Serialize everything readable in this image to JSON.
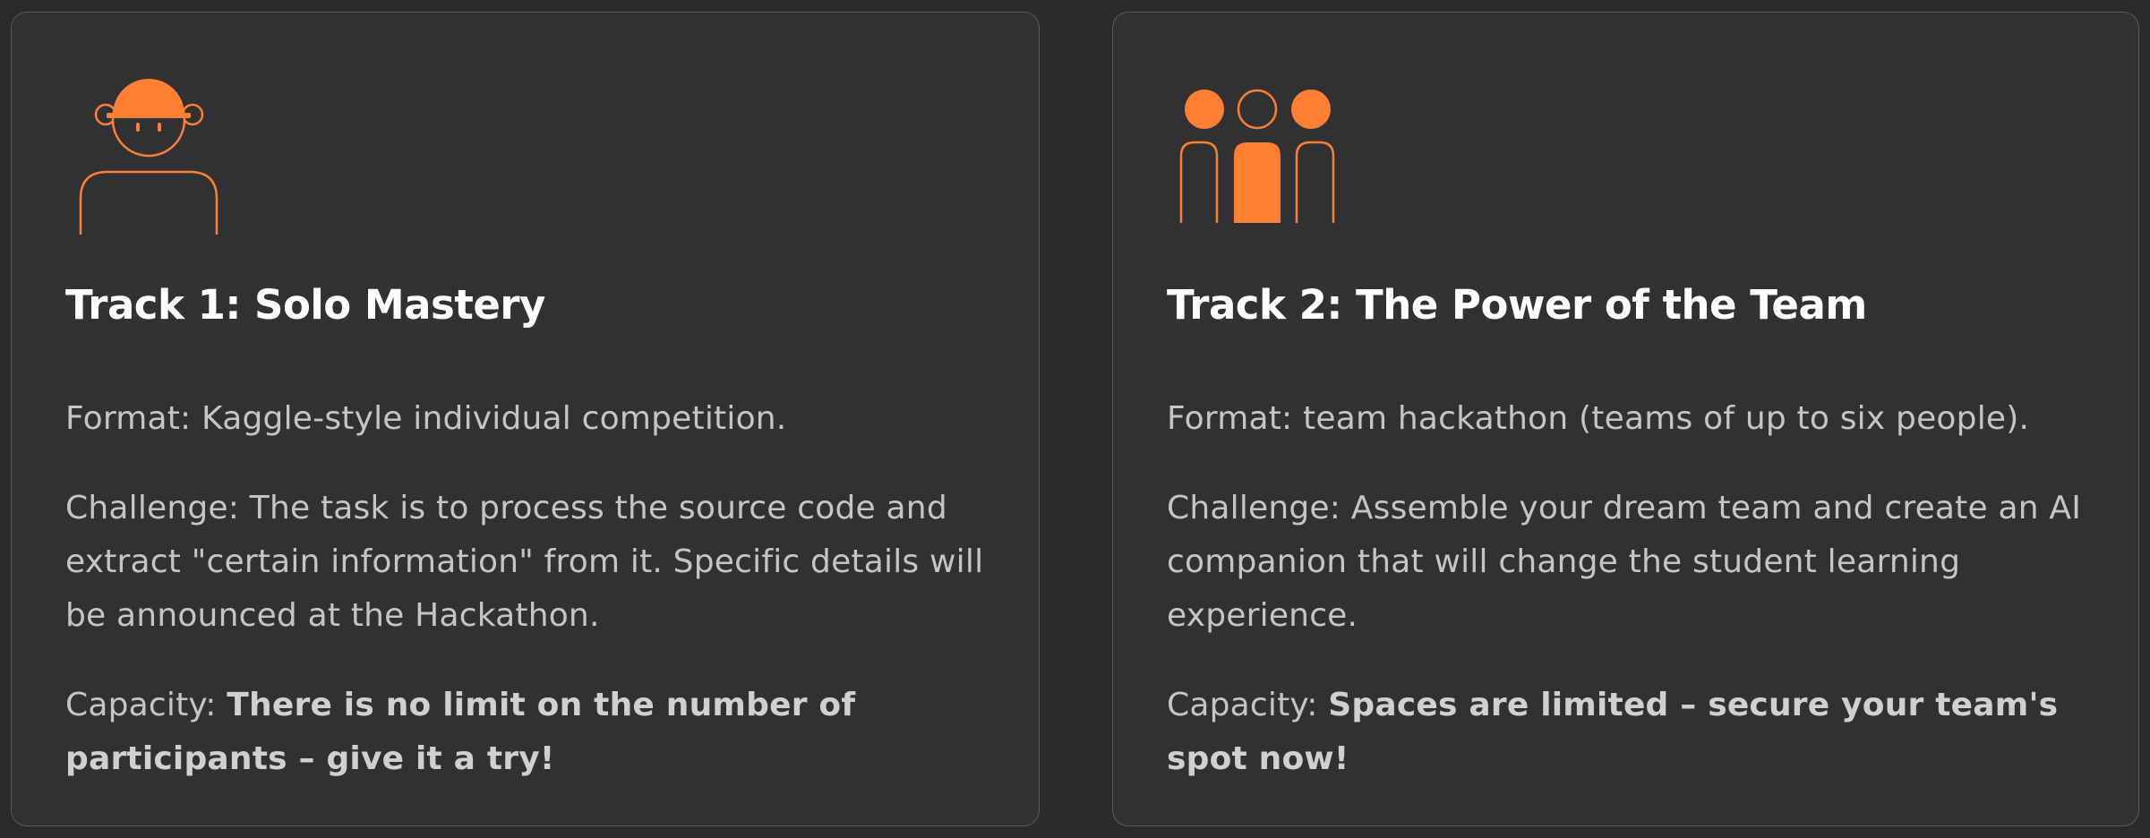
{
  "accent_color": "#ff7f32",
  "tracks": [
    {
      "icon": "solo-person-icon",
      "title": "Track 1: Solo Mastery",
      "format_label": "Format:",
      "format_text": "Kaggle-style individual competition.",
      "challenge_label": "Challenge:",
      "challenge_text": "The task is to process the source code and extract \"certain information\" from it. Specific details will be announced at the Hackathon.",
      "capacity_label": "Capacity:",
      "capacity_text": "There is no limit on the number of participants – give it a try!"
    },
    {
      "icon": "team-people-icon",
      "title": "Track 2: The Power of the Team",
      "format_label": "Format:",
      "format_text": "team hackathon (teams of up to six people).",
      "challenge_label": "Challenge:",
      "challenge_text": "Assemble your dream team and create an AI companion that will change the student learning experience.",
      "capacity_label": "Capacity:",
      "capacity_text": "Spaces are limited – secure your team's spot now!"
    }
  ]
}
